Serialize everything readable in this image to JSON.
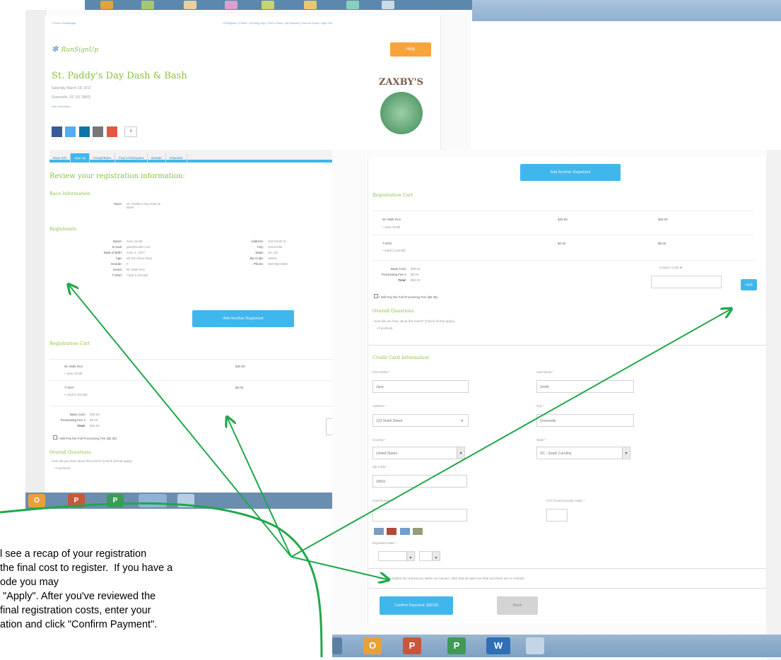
{
  "left_screen": {
    "breadcrumb": "« Event Homepage",
    "top_links": [
      "Hi Register",
      "Profile",
      "Sending App",
      "Find a Race",
      "My Results",
      "Find an Event",
      "Sign Out"
    ],
    "logo": "RunSignUp",
    "help_button": "Help",
    "event_title": "St. Paddy's Day Dash & Bash",
    "event_date": "Saturday March 18, 2017",
    "event_location": "Greenville, SC US 29601",
    "see_directions": "See Directions",
    "sponsor_name": "ZAXBY'S",
    "share_count": "0",
    "tabs": [
      "Race Info",
      "Sign Up",
      "Group/Team",
      "Find A Participant",
      "Donate",
      "Volunteer"
    ],
    "review_heading": "Review your registration information:",
    "race_info_heading": "Race Information",
    "race_label": "Race:",
    "race_value": "St. Paddy's Day Dash & Bash",
    "registrants_heading": "Registrants",
    "registrant_fields": [
      {
        "label": "Name:",
        "value": "Jane Smith"
      },
      {
        "label": "E-mail:",
        "value": "jane@smith.com"
      },
      {
        "label": "Date of Birth:",
        "value": "June 1, 1977"
      },
      {
        "label": "Age:",
        "value": "39 (On Race Day)"
      },
      {
        "label": "Gender:",
        "value": "F"
      },
      {
        "label": "Event:",
        "value": "5K Walk Run"
      },
      {
        "label": "T-Shirt:",
        "value": "Adult S (Small)"
      }
    ],
    "registrant_fields_right": [
      {
        "label": "Address:",
        "value": "123 Smith St"
      },
      {
        "label": "City:",
        "value": "Greenville"
      },
      {
        "label": "State:",
        "value": "SC US"
      },
      {
        "label": "Zip Code:",
        "value": "29601"
      },
      {
        "label": "Phone:",
        "value": "864-555-5555"
      }
    ],
    "add_registrant_button": "Add Another Registrant",
    "cart_heading": "Registration Cart",
    "cart_items": [
      {
        "name": "5K Walk Run",
        "sub": "• Jane Smith",
        "price": "$30.00"
      },
      {
        "name": "T-Shirt",
        "sub": "• Adult S (Small)",
        "price": "$0.00"
      }
    ],
    "base_cost_label": "Base Cost:",
    "base_cost": "$30.00",
    "processing_fee_label": "Processing Fee",
    "processing_fee": "$0.00",
    "total_label": "Total:",
    "total": "$30.00",
    "pay_fee_checkbox": "I Will Pay the Full Processing Fee ($2.38)",
    "overall_questions_heading": "Overall Questions",
    "question_text": "How did you hear about this event? (Check all that apply)",
    "question_answer": "• Facebook"
  },
  "right_screen": {
    "add_registrant_button": "Add Another Registrant",
    "cart_heading": "Registration Cart",
    "cart_items": [
      {
        "name": "5K Walk Run",
        "sub": "• Jane Smith",
        "price": "$30.00",
        "total": "$30.00"
      },
      {
        "name": "T-Shirt",
        "sub": "• Adult S (Small)",
        "price": "$0.00",
        "total": "$0.00"
      }
    ],
    "base_cost_label": "Base Cost:",
    "base_cost": "$30.00",
    "processing_fee_label": "Processing Fee",
    "processing_fee": "$0.00",
    "total_label": "Total:",
    "total": "$30.00",
    "coupon_label": "Coupon Code",
    "apply_button": "Apply",
    "pay_fee_checkbox": "I Will Pay the Full Processing Fee ($2.38)",
    "overall_questions_heading": "Overall Questions",
    "question_text": "How did you hear about this event? (Check all that apply)",
    "question_answer": "• Facebook",
    "cc_heading": "Credit Card Information",
    "first_name_label": "First Name *",
    "first_name": "Jane",
    "last_name_label": "Last Name *",
    "last_name": "Smith",
    "address_label": "Address *",
    "address": "123 Smith Street",
    "city_label": "City *",
    "city": "Greenville",
    "country_label": "Country *",
    "country": "United States",
    "state_label": "State *",
    "state": "SC - South Carolina",
    "zip_label": "Zip Code *",
    "zip": "29601",
    "card_number_label": "Card Number *",
    "cvv_label": "CVV (Card security code) *",
    "expiration_label": "Expiration Date *",
    "timer_note": "Please complete this transaction within 15 minutes. After that all sales are final and there are no refunds.",
    "confirm_button": "Confirm Payment: $30.00",
    "back_button": "Back"
  },
  "instructions": [
    "l see a recap of your registration",
    "the final cost to register.  If you have a",
    "ode you may",
    " \"Apply\". After you've reviewed the",
    "final registration costs, enter your",
    "ation and click \"Confirm Payment\"."
  ],
  "colors": {
    "accent_green": "#8cbf3f",
    "button_blue": "#40b7ec",
    "help_orange": "#f7a43c",
    "arrow_green": "#1fa84a"
  }
}
